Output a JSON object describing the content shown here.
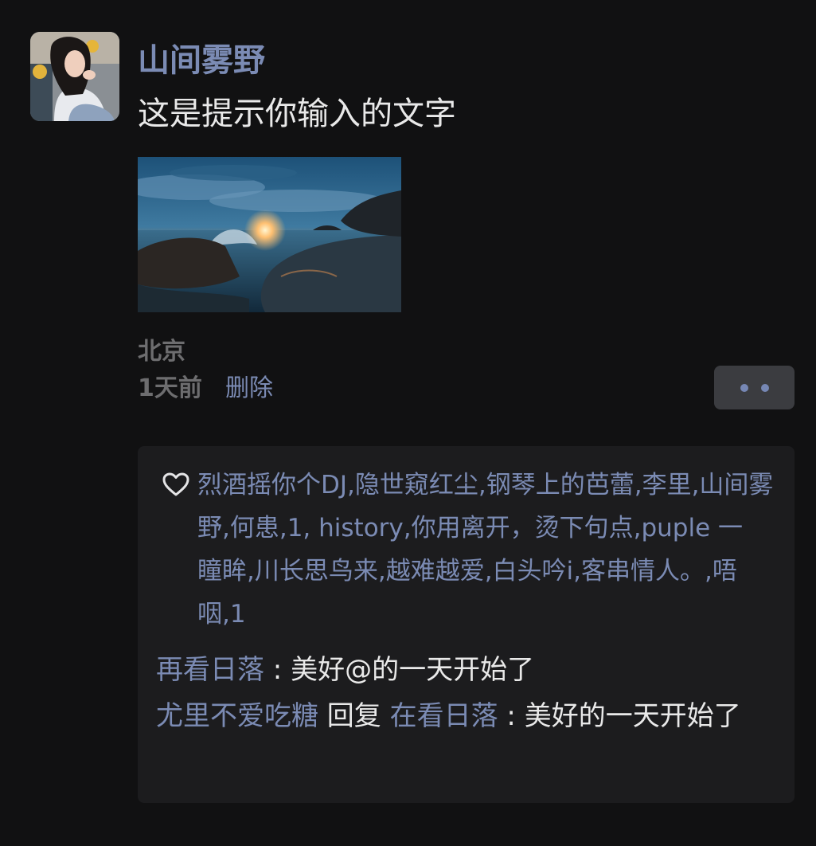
{
  "post": {
    "author": "山间雾野",
    "text": "这是提示你输入的文字",
    "location": "北京",
    "time": "1天前",
    "delete_label": "删除",
    "more_icon": "more-dots-icon"
  },
  "likes": {
    "icon": "heart-icon",
    "text": "烈酒摇你个DJ,隐世窥红尘,钢琴上的芭蕾,李里,山间雾野,何患,1, history,你用离开，烫下句点,puple 一 瞳眸,川长思鸟来,越难越爱,白头吟i,客串情人。,唔咽,1"
  },
  "comments": [
    {
      "user": "再看日落",
      "separator": " : ",
      "content": "美好@的一天开始了"
    },
    {
      "user": "尤里不爱吃糖",
      "reply_word": " 回复 ",
      "reply_to": "在看日落",
      "separator": " : ",
      "content": "美好的一天开始了"
    }
  ],
  "colors": {
    "background": "#111112",
    "name": "#7b8bb4",
    "text": "#e9e9e9",
    "muted": "#6d6d6f",
    "panel": "#1c1c1e",
    "button": "#3b3c40"
  }
}
